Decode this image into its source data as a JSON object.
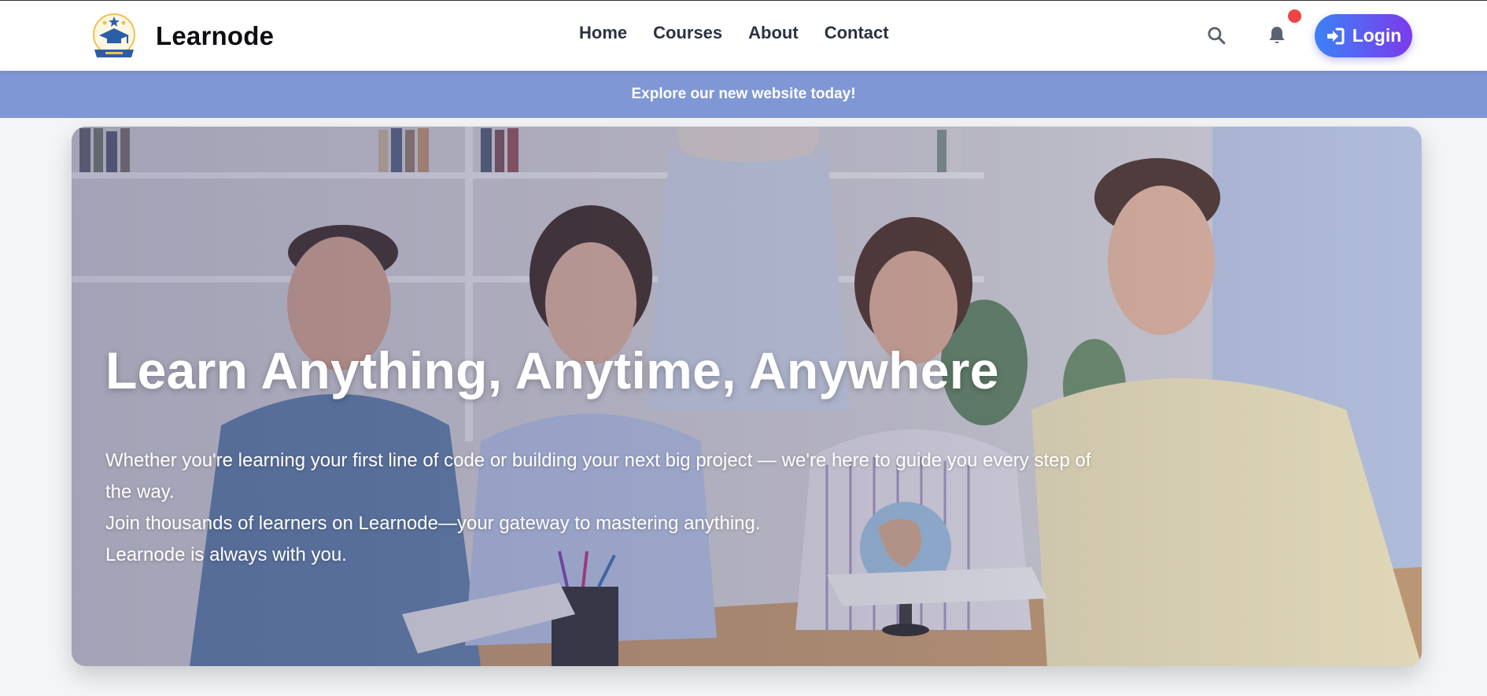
{
  "header": {
    "brand_name": "Learnode",
    "logo_icon": "graduation-cap-logo-icon",
    "nav": [
      {
        "label": "Home"
      },
      {
        "label": "Courses"
      },
      {
        "label": "About"
      },
      {
        "label": "Contact"
      }
    ],
    "search_icon": "search-icon",
    "bell_icon": "bell-icon",
    "login_label": "Login",
    "login_icon": "sign-in-icon",
    "accent_gradient": [
      "#3b82f6",
      "#7c3aed"
    ],
    "notification_dot_color": "#ef4444"
  },
  "banner": {
    "text": "Explore our new website today!",
    "color": "#7f97d4"
  },
  "hero": {
    "title": "Learn Anything, Anytime, Anywhere",
    "paragraphs": [
      "Whether you're learning your first line of code or building your next big project — we're here to guide you every step of the way.",
      "Join thousands of learners on Learnode—your gateway to mastering anything.",
      "Learnode is always with you."
    ],
    "image": "group-of-smiling-students-photo"
  }
}
